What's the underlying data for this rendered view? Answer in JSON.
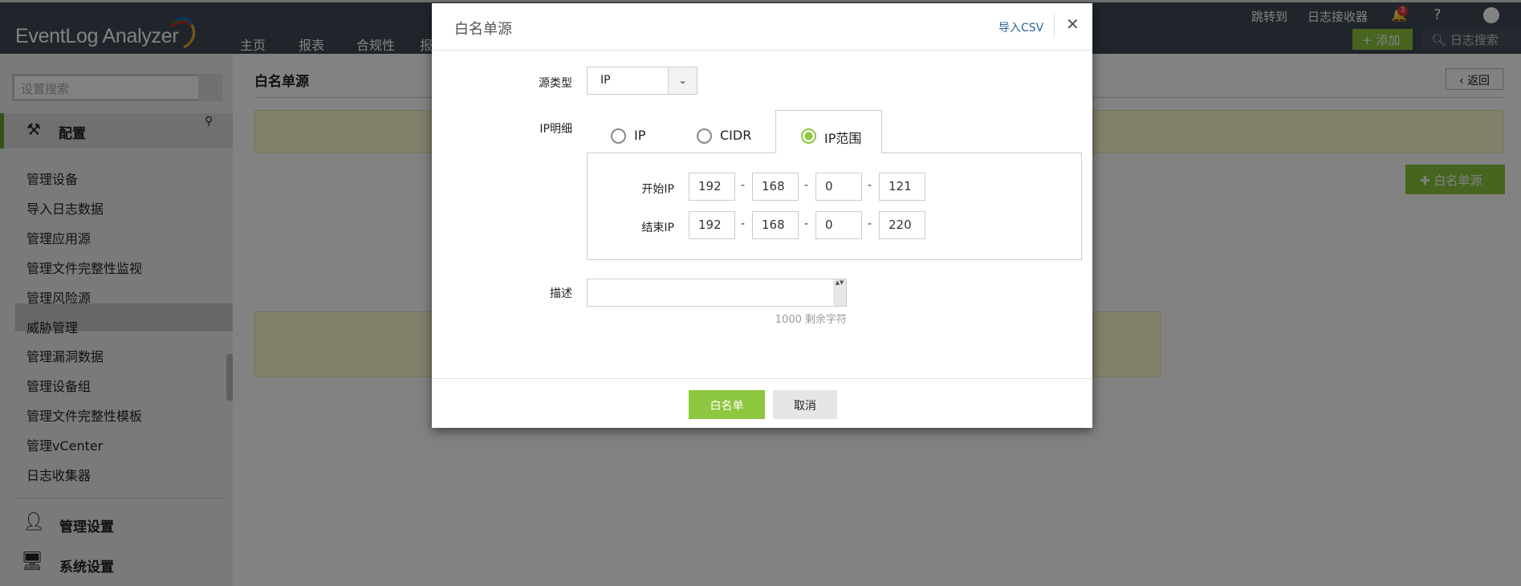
{
  "app": {
    "logo": "EventLog Analyzer",
    "nav": [
      "主页",
      "报表",
      "合规性",
      "报"
    ],
    "top_right": {
      "jump": "跳转到",
      "log_receiver": "日志接收器",
      "notification_count": "3",
      "help": "?",
      "add": "添加",
      "log_search": "日志搜索"
    }
  },
  "sidebar": {
    "search_placeholder": "设置搜索",
    "section": "配置",
    "items": [
      "管理设备",
      "导入日志数据",
      "管理应用源",
      "管理文件完整性监视",
      "管理风险源",
      "威胁管理",
      "管理漏洞数据",
      "管理设备组",
      "管理文件完整性模板",
      "管理vCenter",
      "日志收集器"
    ],
    "selected": "威胁管理",
    "sections": [
      "管理设置",
      "系统设置"
    ]
  },
  "main": {
    "title": "白名单源",
    "back": "返回",
    "add_whitelist": "白名单源"
  },
  "modal": {
    "title": "白名单源",
    "import_csv": "导入CSV",
    "source_type_label": "源类型",
    "source_type_value": "IP",
    "ip_detail_label": "IP明细",
    "tabs": [
      "IP",
      "CIDR",
      "IP范围"
    ],
    "active_tab": "IP范围",
    "start_ip_label": "开始IP",
    "start_ip": [
      "192",
      "168",
      "0",
      "121"
    ],
    "end_ip_label": "结束IP",
    "end_ip": [
      "192",
      "168",
      "0",
      "220"
    ],
    "dash": "-",
    "description_label": "描述",
    "description_value": "",
    "remaining": "1000 剩余字符",
    "submit": "白名单",
    "cancel": "取消"
  },
  "colors": {
    "accent_green": "#8dc63f",
    "topbar": "#3f4a55",
    "link": "#2a6496"
  }
}
